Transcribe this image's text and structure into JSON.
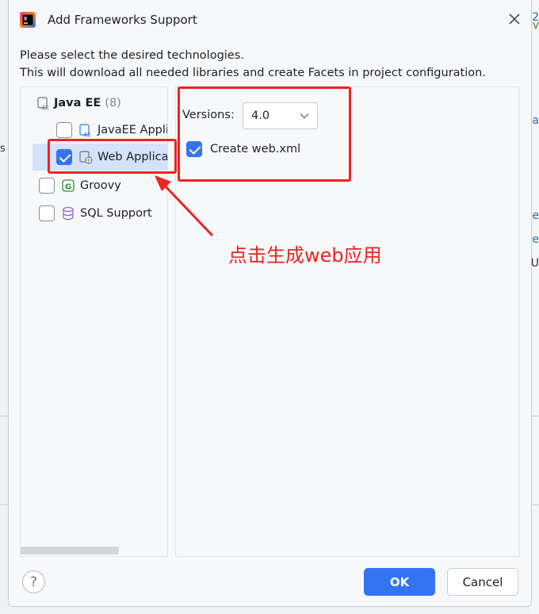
{
  "background": {
    "right_letters": [
      "2",
      "v",
      "a",
      "e",
      "e",
      "U"
    ],
    "left_letter": "s"
  },
  "dialog": {
    "title": "Add Frameworks Support",
    "desc_line1": "Please select the desired technologies.",
    "desc_line2": "This will download all needed libraries and create Facets in project configuration."
  },
  "tree": {
    "group": {
      "label": "Java EE",
      "count": "(8)"
    },
    "items": [
      {
        "label": "JavaEE Appli",
        "checked": false,
        "icon": "javaee-app-icon"
      },
      {
        "label": "Web Applica",
        "checked": true,
        "icon": "web-app-icon",
        "selected": true
      },
      {
        "label": "Groovy",
        "checked": false,
        "icon": "groovy-icon"
      },
      {
        "label": "SQL Support",
        "checked": false,
        "icon": "database-icon"
      }
    ]
  },
  "settings": {
    "versions_label": "Versions:",
    "versions_value": "4.0",
    "create_xml_label": "Create web.xml",
    "create_xml_checked": true
  },
  "annotation": {
    "text": "点击生成web应用",
    "color": "#ee2222"
  },
  "buttons": {
    "help": "?",
    "ok": "OK",
    "cancel": "Cancel"
  },
  "colors": {
    "accent": "#3574f0",
    "selection": "#d4e2fb",
    "annotation_red": "#ee2222"
  }
}
